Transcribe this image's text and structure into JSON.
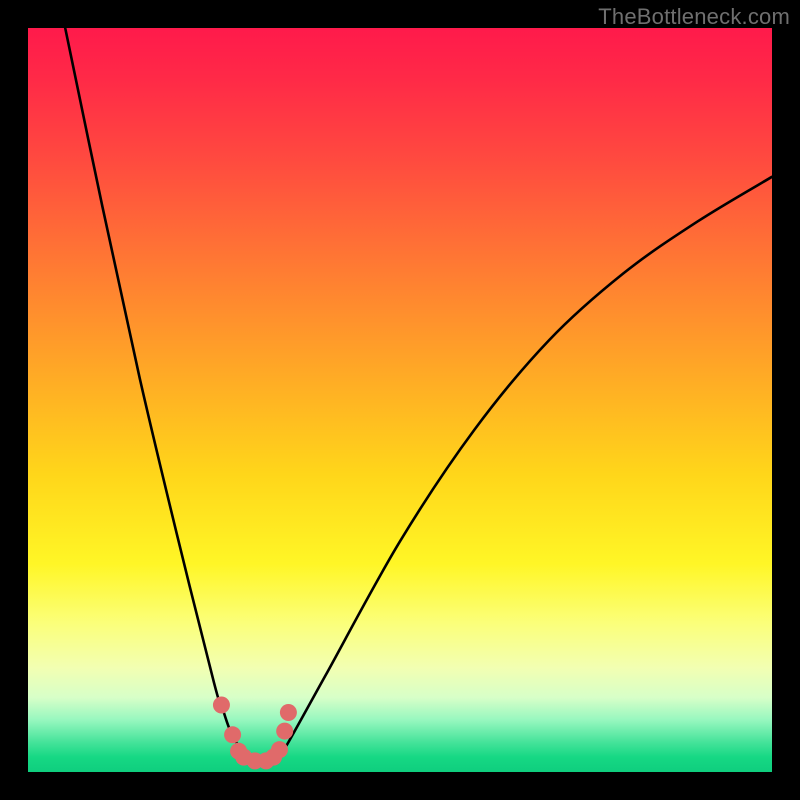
{
  "watermark": "TheBottleneck.com",
  "chart_data": {
    "type": "line",
    "title": "",
    "xlabel": "",
    "ylabel": "",
    "xlim": [
      0,
      100
    ],
    "ylim": [
      0,
      100
    ],
    "series": [
      {
        "name": "bottleneck-curve",
        "x": [
          5,
          10,
          15,
          20,
          25,
          26,
          27,
          28,
          29,
          30,
          31,
          32,
          33,
          34,
          35,
          40,
          50,
          60,
          70,
          80,
          90,
          100
        ],
        "values": [
          100,
          76,
          53,
          32,
          12,
          9,
          6,
          4,
          2.5,
          1.8,
          1.4,
          1.4,
          1.8,
          2.6,
          4,
          13,
          31,
          46,
          58,
          67,
          74,
          80
        ]
      }
    ],
    "markers": {
      "name": "highlight-dots",
      "color": "#e06a6a",
      "points": [
        {
          "x": 26.0,
          "y": 9.0
        },
        {
          "x": 27.5,
          "y": 5.0
        },
        {
          "x": 28.3,
          "y": 2.8
        },
        {
          "x": 29.0,
          "y": 2.0
        },
        {
          "x": 30.5,
          "y": 1.5
        },
        {
          "x": 32.0,
          "y": 1.5
        },
        {
          "x": 33.0,
          "y": 2.0
        },
        {
          "x": 33.8,
          "y": 3.0
        },
        {
          "x": 34.5,
          "y": 5.5
        },
        {
          "x": 35.0,
          "y": 8.0
        }
      ]
    },
    "gradient_stops": [
      {
        "pos": 0,
        "color": "#ff1a4b"
      },
      {
        "pos": 7,
        "color": "#ff2a47"
      },
      {
        "pos": 18,
        "color": "#ff4b3f"
      },
      {
        "pos": 32,
        "color": "#ff7a33"
      },
      {
        "pos": 46,
        "color": "#ffa826"
      },
      {
        "pos": 60,
        "color": "#ffd61a"
      },
      {
        "pos": 72,
        "color": "#fff626"
      },
      {
        "pos": 80,
        "color": "#fbff7a"
      },
      {
        "pos": 86,
        "color": "#f2ffb2"
      },
      {
        "pos": 90,
        "color": "#d7ffc8"
      },
      {
        "pos": 93,
        "color": "#97f7bf"
      },
      {
        "pos": 96,
        "color": "#45e39a"
      },
      {
        "pos": 98,
        "color": "#16d884"
      },
      {
        "pos": 100,
        "color": "#0fce7e"
      }
    ]
  }
}
